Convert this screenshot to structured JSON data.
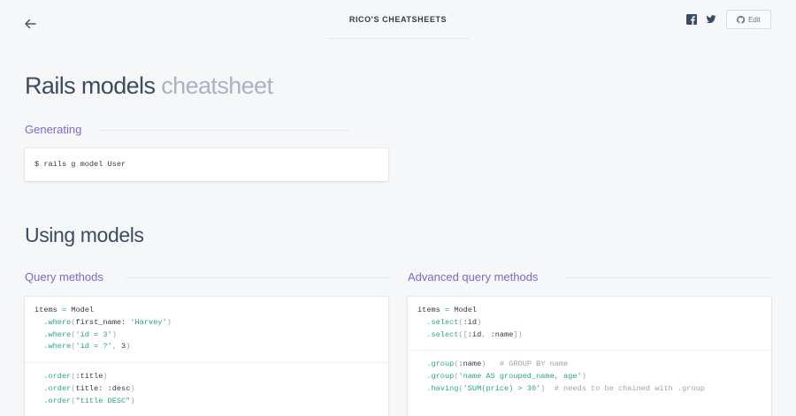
{
  "header": {
    "brand": "RICO'S CHEATSHEETS",
    "edit_label": "Edit",
    "icons": {
      "back": "back-arrow-icon",
      "facebook": "facebook-icon",
      "twitter": "twitter-icon",
      "github": "github-icon"
    }
  },
  "page": {
    "title_main": "Rails models",
    "title_muted": "cheatsheet"
  },
  "sections": {
    "generating": {
      "heading": "Generating",
      "command": "$ rails g model User"
    },
    "using": {
      "heading": "Using models"
    },
    "query": {
      "heading": "Query methods",
      "blocks": [
        [
          [
            [
              "items ",
              "c-id"
            ],
            [
              "=",
              "c-op"
            ],
            [
              " Model",
              "c-id"
            ]
          ],
          [
            [
              "  .where",
              "c-method"
            ],
            [
              "(",
              "c-punc"
            ],
            [
              "first_name:",
              "c-sym"
            ],
            [
              " ",
              "c-id"
            ],
            [
              "'Harvey'",
              "c-str"
            ],
            [
              ")",
              "c-punc"
            ]
          ],
          [
            [
              "  .where",
              "c-method"
            ],
            [
              "(",
              "c-punc"
            ],
            [
              "'id = 3'",
              "c-str"
            ],
            [
              ")",
              "c-punc"
            ]
          ],
          [
            [
              "  .where",
              "c-method"
            ],
            [
              "(",
              "c-punc"
            ],
            [
              "'id = ?'",
              "c-str"
            ],
            [
              ", ",
              "c-punc"
            ],
            [
              "3",
              "c-id"
            ],
            [
              ")",
              "c-punc"
            ]
          ]
        ],
        [
          [
            [
              "  .order",
              "c-method"
            ],
            [
              "(",
              "c-punc"
            ],
            [
              ":title",
              "c-sym"
            ],
            [
              ")",
              "c-punc"
            ]
          ],
          [
            [
              "  .order",
              "c-method"
            ],
            [
              "(",
              "c-punc"
            ],
            [
              "title:",
              "c-sym"
            ],
            [
              " ",
              "c-id"
            ],
            [
              ":desc",
              "c-sym"
            ],
            [
              ")",
              "c-punc"
            ]
          ],
          [
            [
              "  .order",
              "c-method"
            ],
            [
              "(",
              "c-punc"
            ],
            [
              "\"title DESC\"",
              "c-str"
            ],
            [
              ")",
              "c-punc"
            ]
          ]
        ]
      ]
    },
    "advanced": {
      "heading": "Advanced query methods",
      "blocks": [
        [
          [
            [
              "items ",
              "c-id"
            ],
            [
              "=",
              "c-op"
            ],
            [
              " Model",
              "c-id"
            ]
          ],
          [
            [
              "  .select",
              "c-method"
            ],
            [
              "(",
              "c-punc"
            ],
            [
              ":id",
              "c-sym"
            ],
            [
              ")",
              "c-punc"
            ]
          ],
          [
            [
              "  .select",
              "c-method"
            ],
            [
              "([",
              "c-punc"
            ],
            [
              ":id",
              "c-sym"
            ],
            [
              ", ",
              "c-punc"
            ],
            [
              ":name",
              "c-sym"
            ],
            [
              "])",
              "c-punc"
            ]
          ]
        ],
        [
          [
            [
              "  .group",
              "c-method"
            ],
            [
              "(",
              "c-punc"
            ],
            [
              ":name",
              "c-sym"
            ],
            [
              ")",
              "c-punc"
            ],
            [
              "   # GROUP BY name",
              "c-cmt"
            ]
          ],
          [
            [
              "  .group",
              "c-method"
            ],
            [
              "(",
              "c-punc"
            ],
            [
              "'name AS grouped_name, age'",
              "c-str"
            ],
            [
              ")",
              "c-punc"
            ]
          ],
          [
            [
              "  .having",
              "c-method"
            ],
            [
              "(",
              "c-punc"
            ],
            [
              "'SUM(price) > 30'",
              "c-str"
            ],
            [
              ")",
              "c-punc"
            ],
            [
              "  # needs to be chained with .group",
              "c-cmt"
            ]
          ]
        ]
      ]
    }
  }
}
